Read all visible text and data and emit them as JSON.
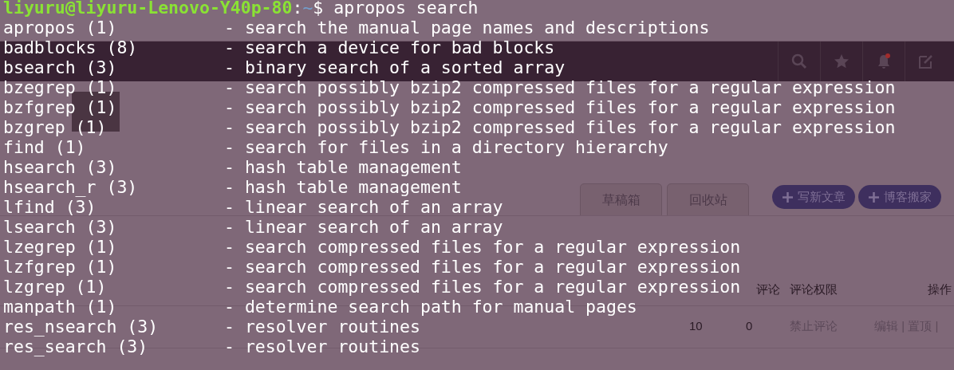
{
  "terminal": {
    "prompt": {
      "user_host": "liyuru@liyuru-Lenovo-Y40p-80",
      "separator": ":",
      "path": "~",
      "symbol": "$",
      "command": "apropos search"
    },
    "lines": [
      {
        "name": "apropos (1)",
        "description": "- search the manual page names and descriptions"
      },
      {
        "name": "badblocks (8)",
        "description": "- search a device for bad blocks"
      },
      {
        "name": "bsearch (3)",
        "description": "- binary search of a sorted array"
      },
      {
        "name": "bzegrep (1)",
        "description": "- search possibly bzip2 compressed files for a regular expression"
      },
      {
        "name": "bzfgrep (1)",
        "description": "- search possibly bzip2 compressed files for a regular expression"
      },
      {
        "name": "bzgrep (1)",
        "description": "- search possibly bzip2 compressed files for a regular expression"
      },
      {
        "name": "find (1)",
        "description": "- search for files in a directory hierarchy"
      },
      {
        "name": "hsearch (3)",
        "description": "- hash table management"
      },
      {
        "name": "hsearch_r (3)",
        "description": "- hash table management"
      },
      {
        "name": "lfind (3)",
        "description": "- linear search of an array"
      },
      {
        "name": "lsearch (3)",
        "description": "- linear search of an array"
      },
      {
        "name": "lzegrep (1)",
        "description": "- search compressed files for a regular expression"
      },
      {
        "name": "lzfgrep (1)",
        "description": "- search compressed files for a regular expression"
      },
      {
        "name": "lzgrep (1)",
        "description": "- search compressed files for a regular expression"
      },
      {
        "name": "manpath (1)",
        "description": "- determine search path for manual pages"
      },
      {
        "name": "res_nsearch (3)",
        "description": "- resolver routines"
      },
      {
        "name": "res_search (3)",
        "description": "- resolver routines"
      }
    ]
  },
  "browser_behind": {
    "header_icons": [
      {
        "kind": "search"
      },
      {
        "kind": "star"
      },
      {
        "kind": "bell"
      },
      {
        "kind": "edit"
      }
    ],
    "tabs": [
      {
        "label": "草稿箱",
        "selected": false
      },
      {
        "label": "回收站",
        "selected": false
      }
    ],
    "buttons": [
      "写新文章",
      "博客搬家"
    ],
    "table_headers": {
      "comments": "评论",
      "comment_permission": "评论权限",
      "actions": "操作"
    },
    "article_row": {
      "read_count": "10",
      "comment_count": "0",
      "comment_permission": "禁止评论",
      "actions": "编辑 | 置顶 |"
    }
  }
}
